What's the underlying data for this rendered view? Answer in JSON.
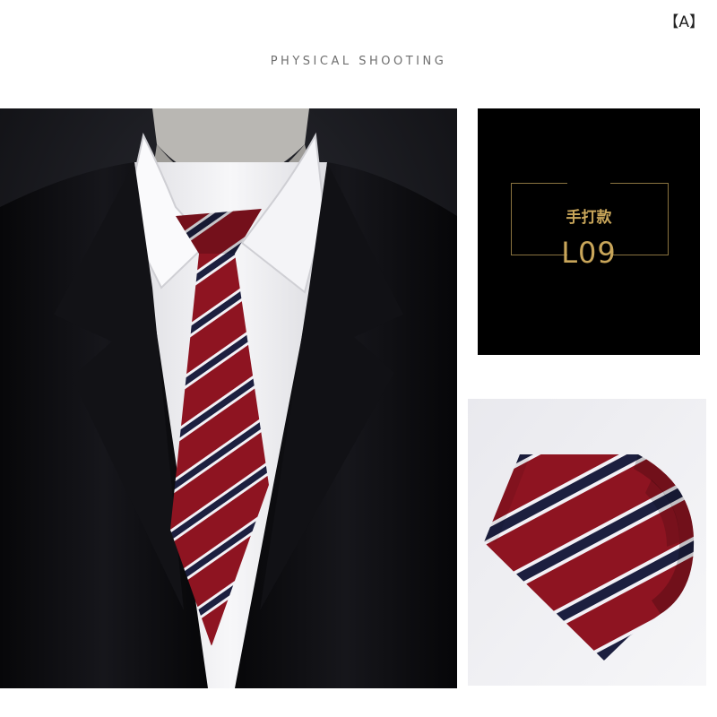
{
  "corner_tag": "【A】",
  "header": {
    "title": "PHYSICAL SHOOTING"
  },
  "code_panel": {
    "style_label": "手打款",
    "code": "L09",
    "accent_color": "#c9a65a"
  },
  "colors": {
    "tie_base": "#8e1421",
    "stripe_navy": "#1c1f3f",
    "stripe_white": "#f3f1f6",
    "suit": "#0d0d10"
  },
  "images": {
    "main": "suit-with-striped-tie-photo",
    "detail": "rolled-striped-tie-photo"
  }
}
